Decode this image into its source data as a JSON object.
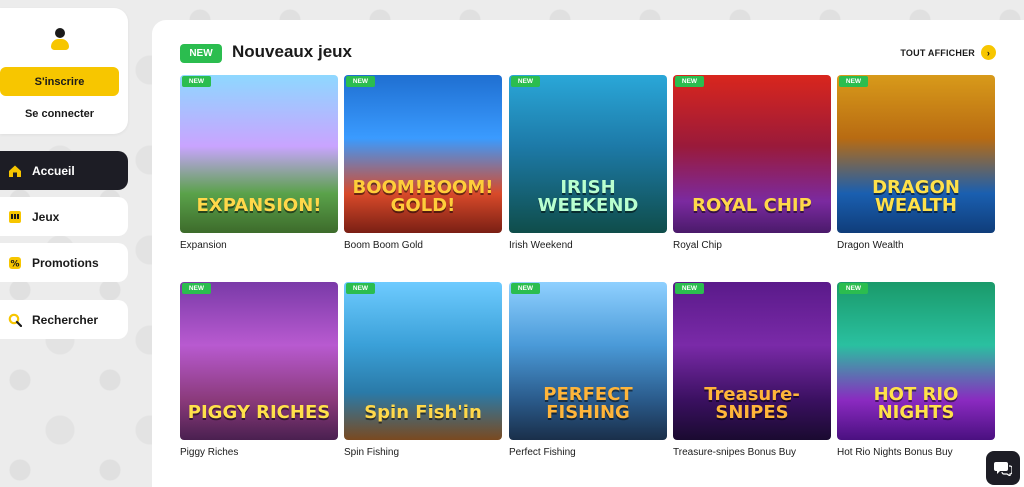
{
  "auth": {
    "signup_label": "S'inscrire",
    "login_label": "Se connecter"
  },
  "nav": [
    {
      "label": "Accueil",
      "icon": "home-icon",
      "active": true
    },
    {
      "label": "Jeux",
      "icon": "slot-machine-icon",
      "active": false
    },
    {
      "label": "Promotions",
      "icon": "percent-icon",
      "active": false
    },
    {
      "label": "Rechercher",
      "icon": "search-icon",
      "active": false
    }
  ],
  "section": {
    "badge": "NEW",
    "title": "Nouveaux jeux",
    "see_all": "TOUT AFFICHER"
  },
  "games": [
    {
      "name": "Expansion",
      "tag": "NEW",
      "logo": "EXPANSION!",
      "logo_color": "#ffd84a",
      "bg": "linear-gradient(180deg,#8ed8ff 0%,#c9a4ff 45%,#5aa24a 75%,#3d6b2b 100%)"
    },
    {
      "name": "Boom Boom Gold",
      "tag": "NEW",
      "logo": "BOOM!BOOM! GOLD!",
      "logo_color": "#ffce3a",
      "bg": "linear-gradient(180deg,#1f6fd1 0%,#3a9bff 40%,#d84a2a 75%,#7a1f14 100%)"
    },
    {
      "name": "Irish Weekend",
      "tag": "NEW",
      "logo": "IRISH WEEKEND",
      "logo_color": "#b8ffcf",
      "bg": "linear-gradient(180deg,#2aa7d8 0%,#1d7aa8 45%,#0f4d4a 100%)"
    },
    {
      "name": "Royal Chip",
      "tag": "NEW",
      "logo": "ROYAL CHIP",
      "logo_color": "#ffd84a",
      "bg": "linear-gradient(180deg,#d9261d 0%,#9a1a3a 45%,#7b2aa0 80%,#4a1a6a 100%)"
    },
    {
      "name": "Dragon Wealth",
      "tag": "NEW",
      "logo": "DRAGON WEALTH",
      "logo_color": "#ffe14a",
      "bg": "linear-gradient(180deg,#d89a1a 0%,#b86b12 40%,#1a5fb0 75%,#0f3d7a 100%)"
    },
    {
      "name": "Piggy Riches",
      "tag": "NEW",
      "logo": "PIGGY RICHES",
      "logo_color": "#ffe14a",
      "bg": "linear-gradient(180deg,#7a3aa8 0%,#b85ad0 40%,#8a3a7a 75%,#4a2050 100%)"
    },
    {
      "name": "Spin Fishing",
      "tag": "NEW",
      "logo": "Spin Fish'in",
      "logo_color": "#ffd84a",
      "bg": "linear-gradient(180deg,#6ecbff 0%,#3aa0d8 40%,#2a7aa8 70%,#7a4a20 100%)"
    },
    {
      "name": "Perfect Fishing",
      "tag": "NEW",
      "logo": "PERFECT FISHING",
      "logo_color": "#ffb53a",
      "bg": "linear-gradient(180deg,#8fd0ff 0%,#4a9ad8 40%,#2a5a8a 75%,#1a2f4a 100%)"
    },
    {
      "name": "Treasure-snipes Bonus Buy",
      "tag": "NEW",
      "logo": "Treasure-SNIPES",
      "logo_color": "#ffb53a",
      "bg": "linear-gradient(180deg,#5a1a8a 0%,#7a2aa8 40%,#3a1060 75%,#1a0a30 100%)"
    },
    {
      "name": "Hot Rio Nights Bonus Buy",
      "tag": "NEW",
      "logo": "HOT RIO NIGHTS",
      "logo_color": "#ffe14a",
      "bg": "linear-gradient(180deg,#1a9a6a 0%,#2ac0a0 40%,#8a2ac0 75%,#4a1080 100%)"
    }
  ]
}
